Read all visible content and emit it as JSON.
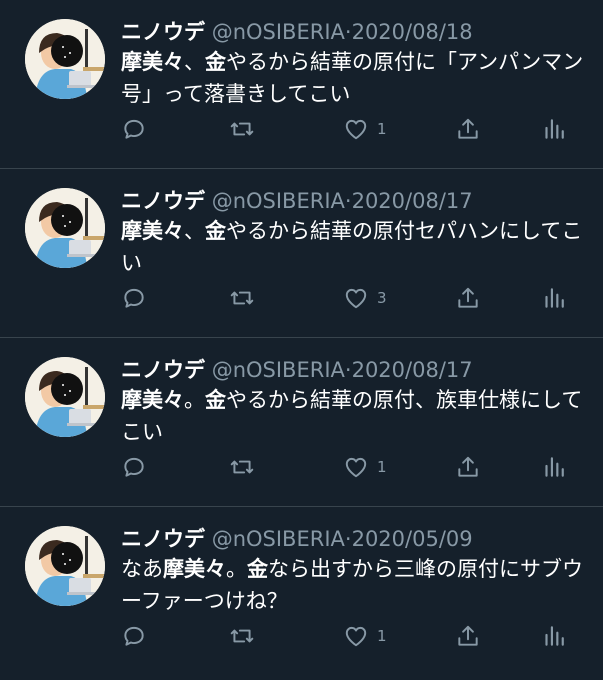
{
  "tweets": [
    {
      "name": "ニノウデ",
      "handle": "@nOSIBERIA",
      "separator": "·",
      "date": "2020/08/18",
      "text": [
        {
          "t": "摩美々",
          "b": true
        },
        {
          "t": "、",
          "b": false
        },
        {
          "t": "金",
          "b": true
        },
        {
          "t": "やるから結華の原付に「アンパンマン号」って落書きしてこい",
          "b": false
        }
      ],
      "likes": "1"
    },
    {
      "name": "ニノウデ",
      "handle": "@nOSIBERIA",
      "separator": "·",
      "date": "2020/08/17",
      "text": [
        {
          "t": "摩美々",
          "b": true
        },
        {
          "t": "、",
          "b": false
        },
        {
          "t": "金",
          "b": true
        },
        {
          "t": "やるから結華の原付セパハンにしてこい",
          "b": false
        }
      ],
      "likes": "3"
    },
    {
      "name": "ニノウデ",
      "handle": "@nOSIBERIA",
      "separator": "·",
      "date": "2020/08/17",
      "text": [
        {
          "t": "摩美々",
          "b": true
        },
        {
          "t": "。",
          "b": false
        },
        {
          "t": "金",
          "b": true
        },
        {
          "t": "やるから結華の原付、族車仕様にしてこい",
          "b": false
        }
      ],
      "likes": "1"
    },
    {
      "name": "ニノウデ",
      "handle": "@nOSIBERIA",
      "separator": "·",
      "date": "2020/05/09",
      "text": [
        {
          "t": "なあ",
          "b": false
        },
        {
          "t": "摩美々",
          "b": true
        },
        {
          "t": "。",
          "b": false
        },
        {
          "t": "金",
          "b": true
        },
        {
          "t": "なら出すから三峰の原付にサブウーファーつけね？",
          "b": false
        }
      ],
      "likes": "1"
    }
  ],
  "icons": {
    "reply": "reply-icon",
    "retweet": "retweet-icon",
    "like": "heart-icon",
    "share": "share-icon",
    "analytics": "analytics-icon"
  },
  "colors": {
    "background": "#15202b",
    "divider": "#38444d",
    "secondary_text": "#8899a6",
    "primary_text": "#ffffff"
  }
}
